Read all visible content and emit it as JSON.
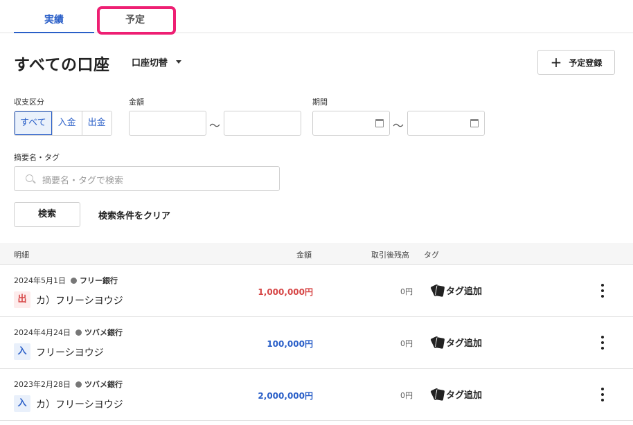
{
  "tabs": {
    "actual": "実績",
    "plan": "予定"
  },
  "header": {
    "title": "すべての口座",
    "account_switch": "口座切替",
    "plan_register": "予定登録",
    "plan_register_icon": "plus-icon"
  },
  "filters": {
    "type_label": "収支区分",
    "type_options": [
      "すべて",
      "入金",
      "出金"
    ],
    "type_selected": "すべて",
    "amount_label": "金額",
    "amount_min": "",
    "amount_max": "",
    "range_sep": "〜",
    "period_label": "期間",
    "period_from": "",
    "period_to": "",
    "memo_label": "摘要名・タグ",
    "memo_placeholder": "摘要名・タグで検索",
    "search_button": "検索",
    "clear_button": "検索条件をクリア"
  },
  "table": {
    "columns": {
      "detail": "明細",
      "amount": "金額",
      "balance": "取引後残高",
      "tag": "タグ"
    },
    "rows": [
      {
        "date": "2024年5月1日",
        "bank": "フリー銀行",
        "type": "出",
        "payee": "カ）フリーシヨウジ",
        "amount": "1,000,000円",
        "balance": "0円",
        "tag_action": "タグ追加"
      },
      {
        "date": "2024年4月24日",
        "bank": "ツバメ銀行",
        "type": "入",
        "payee": "フリーシヨウジ",
        "amount": "100,000円",
        "balance": "0円",
        "tag_action": "タグ追加"
      },
      {
        "date": "2023年2月28日",
        "bank": "ツバメ銀行",
        "type": "入",
        "payee": "カ）フリーシヨウジ",
        "amount": "2,000,000円",
        "balance": "0円",
        "tag_action": "タグ追加"
      }
    ]
  },
  "colors": {
    "accent": "#2a5fc8",
    "expense": "#d64545",
    "highlight": "#ee1f73"
  }
}
